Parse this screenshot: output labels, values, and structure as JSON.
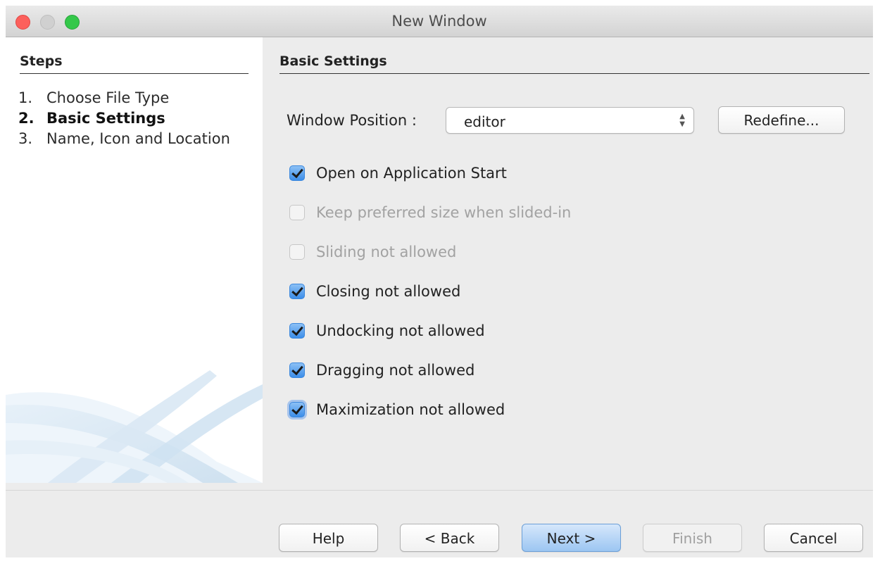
{
  "window": {
    "title": "New Window"
  },
  "sidebar": {
    "heading": "Steps",
    "steps": [
      {
        "number": "1.",
        "label": "Choose File Type",
        "current": false
      },
      {
        "number": "2.",
        "label": "Basic Settings",
        "current": true
      },
      {
        "number": "3.",
        "label": "Name, Icon and Location",
        "current": false
      }
    ]
  },
  "main": {
    "heading": "Basic Settings",
    "window_position": {
      "label": "Window Position :",
      "selected": "editor",
      "redefine_label": "Redefine..."
    },
    "options": [
      {
        "label": "Open on Application Start",
        "checked": true,
        "enabled": true
      },
      {
        "label": "Keep preferred size when slided-in",
        "checked": false,
        "enabled": false
      },
      {
        "label": "Sliding not allowed",
        "checked": false,
        "enabled": false
      },
      {
        "label": "Closing not allowed",
        "checked": true,
        "enabled": true
      },
      {
        "label": "Undocking not allowed",
        "checked": true,
        "enabled": true
      },
      {
        "label": "Dragging not allowed",
        "checked": true,
        "enabled": true
      },
      {
        "label": "Maximization not allowed",
        "checked": true,
        "enabled": true,
        "focused": true
      }
    ]
  },
  "footer": {
    "help": "Help",
    "back": "< Back",
    "next": "Next >",
    "finish": "Finish",
    "cancel": "Cancel"
  }
}
